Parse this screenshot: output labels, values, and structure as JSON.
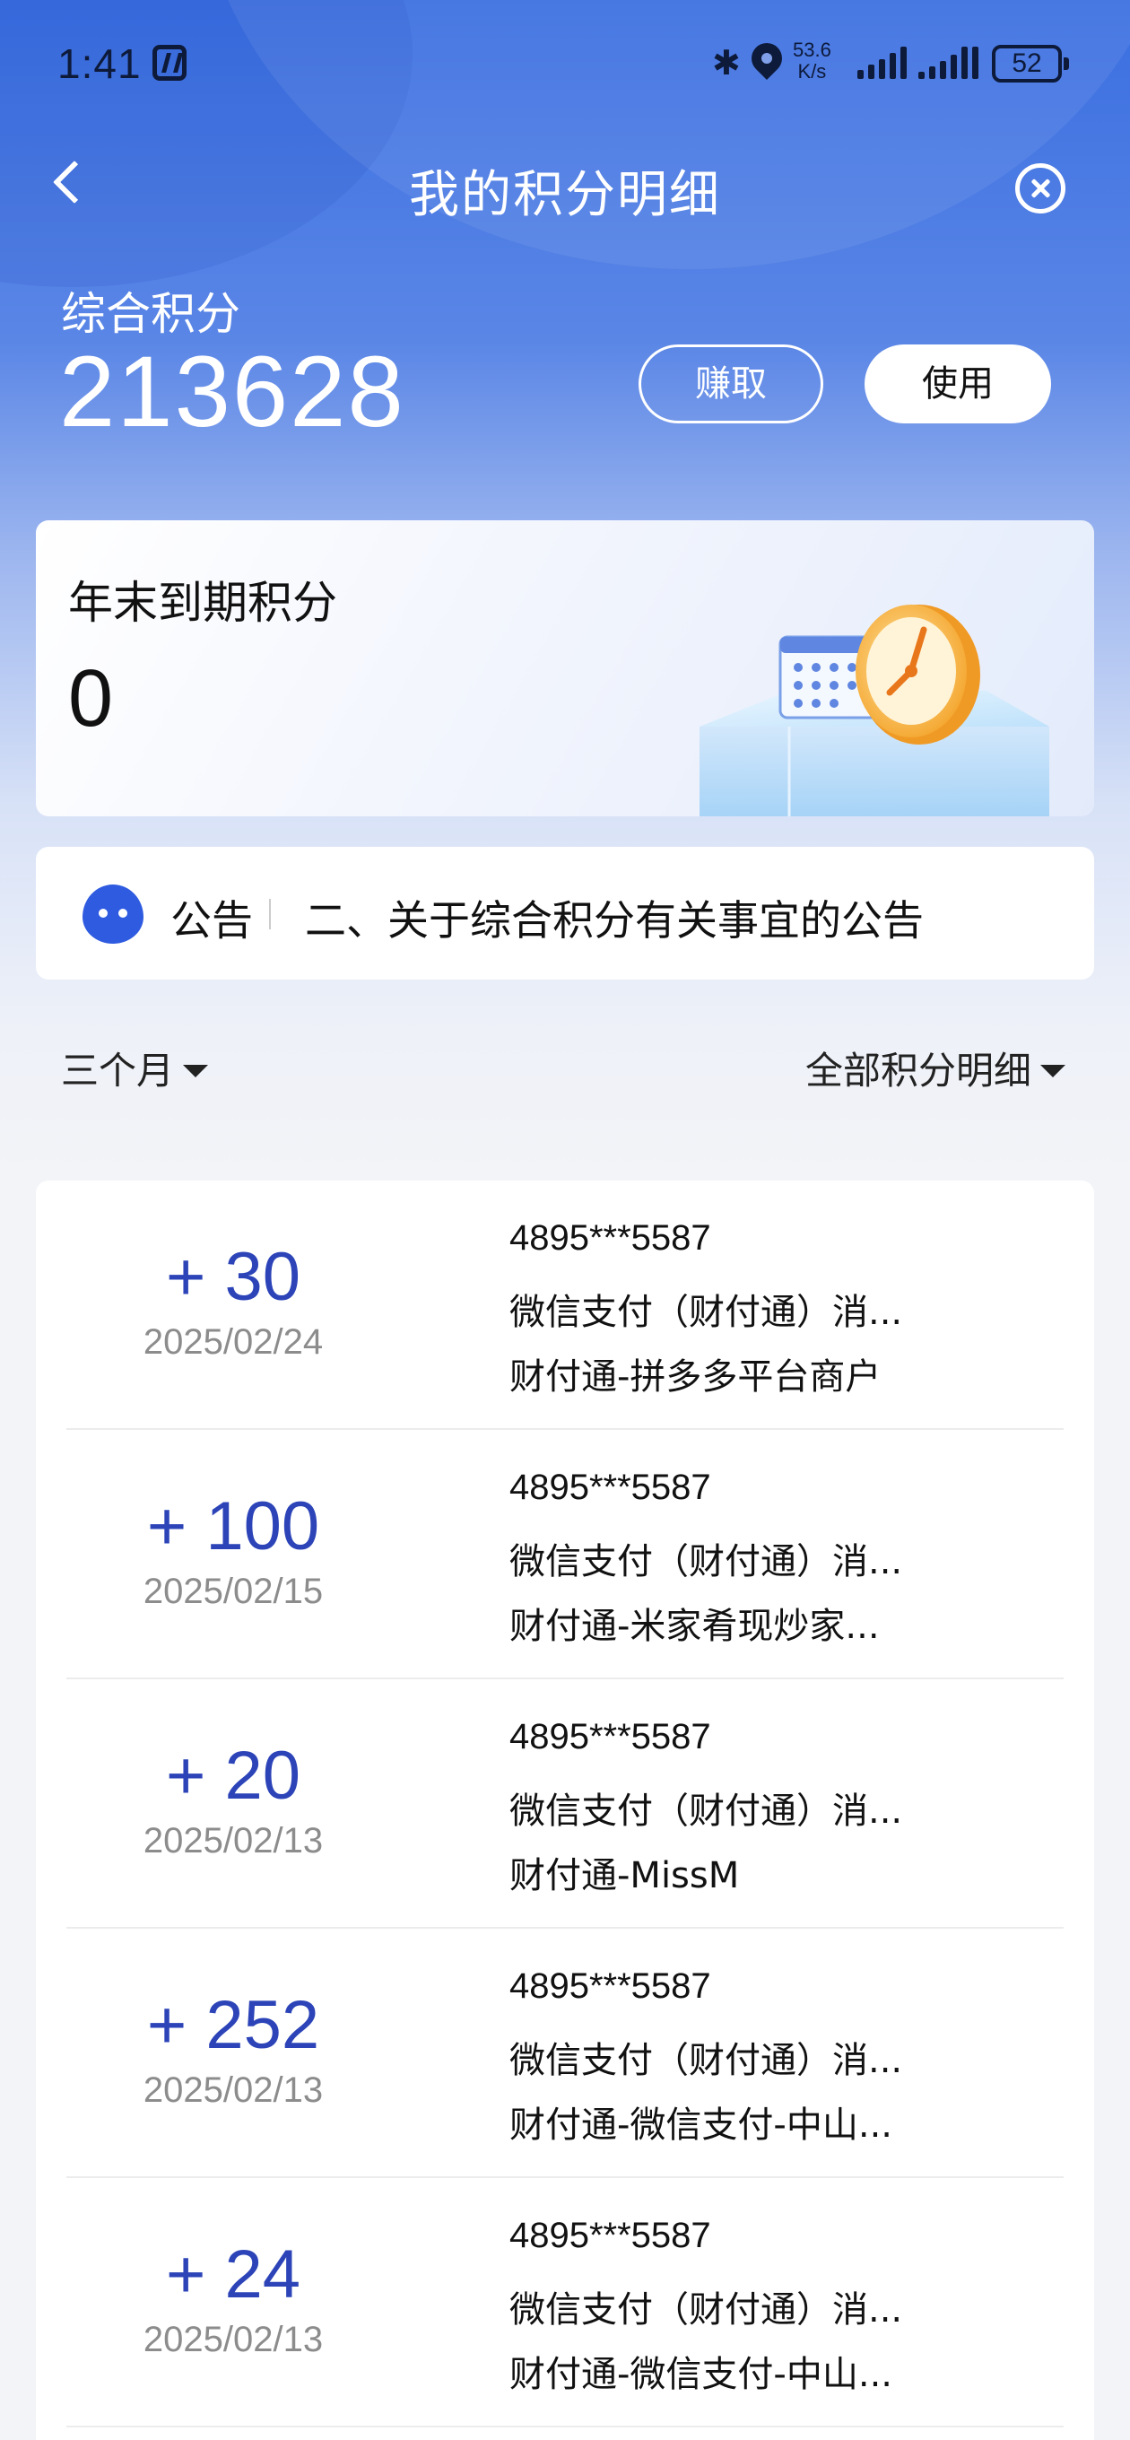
{
  "status_bar": {
    "time": "1:41",
    "net_speed_value": "53.6",
    "net_speed_unit": "K/s",
    "battery": "52",
    "icons": [
      "nfc-icon",
      "bluetooth-icon",
      "location-icon",
      "signal-icon",
      "battery-icon"
    ]
  },
  "header": {
    "title": "我的积分明细"
  },
  "points": {
    "label": "综合积分",
    "value": "213628",
    "earn_label": "赚取",
    "use_label": "使用"
  },
  "expiring": {
    "label": "年末到期积分",
    "value": "0"
  },
  "notice": {
    "tag": "公告",
    "text": "二、关于综合积分有关事宜的公告"
  },
  "filters": {
    "period": "三个月",
    "type": "全部积分明细"
  },
  "transactions": [
    {
      "amount": "+ 30",
      "date": "2025/02/24",
      "card": "4895***5587",
      "desc": "微信支付（财付通）消...",
      "merchant": "财付通-拼多多平台商户"
    },
    {
      "amount": "+ 100",
      "date": "2025/02/15",
      "card": "4895***5587",
      "desc": "微信支付（财付通）消...",
      "merchant": "财付通-米家肴现炒家..."
    },
    {
      "amount": "+ 20",
      "date": "2025/02/13",
      "card": "4895***5587",
      "desc": "微信支付（财付通）消...",
      "merchant": "财付通-MissM"
    },
    {
      "amount": "+ 252",
      "date": "2025/02/13",
      "card": "4895***5587",
      "desc": "微信支付（财付通）消...",
      "merchant": "财付通-微信支付-中山..."
    },
    {
      "amount": "+ 24",
      "date": "2025/02/13",
      "card": "4895***5587",
      "desc": "微信支付（财付通）消...",
      "merchant": "财付通-微信支付-中山..."
    }
  ],
  "colors": {
    "brand_blue": "#3a6ee0",
    "amount_blue": "#2c44b8",
    "notice_icon": "#2f5be0"
  }
}
